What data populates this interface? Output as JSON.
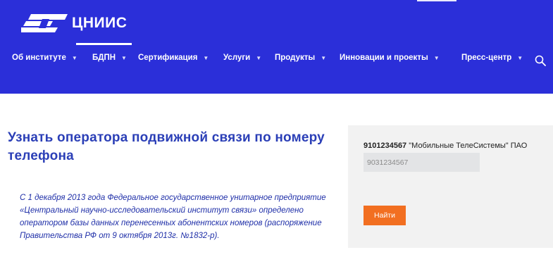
{
  "header": {
    "logo_text": "ЦНИИС",
    "nav": [
      {
        "label": "Об институте",
        "has_dropdown": true
      },
      {
        "label": "БДПН",
        "has_dropdown": true
      },
      {
        "label": "Сертификация",
        "has_dropdown": true
      },
      {
        "label": "Услуги",
        "has_dropdown": true
      },
      {
        "label": "Продукты",
        "has_dropdown": true
      },
      {
        "label": "Инновации и проекты",
        "has_dropdown": true
      },
      {
        "label": "Пресс-центр",
        "has_dropdown": true
      }
    ],
    "search_icon": "search-icon",
    "caret_icon": "chevron-down-icon"
  },
  "main": {
    "title": "Узнать оператора подвижной связи по номеру телефона",
    "notice": "С 1 декабря 2013 года Федеральное государственное унитарное предприятие «Центральный научно-исследовательский институт связи» определено оператором базы данных перенесенных абонентских номеров (распоряжение Правительства РФ от 9 октября 2013г. №1832-р)."
  },
  "lookup": {
    "result_number": "9101234567",
    "result_operator": "\"Мобильные ТелеСистемы\" ПАО",
    "input_placeholder": "9031234567",
    "input_value": "",
    "button_label": "Найти"
  },
  "colors": {
    "header_bg": "#2b2fd9",
    "title": "#2b3fb7",
    "notice_text": "#1f2fa8",
    "panel_bg": "#f2f2f2",
    "button_bg": "#f26f21"
  }
}
